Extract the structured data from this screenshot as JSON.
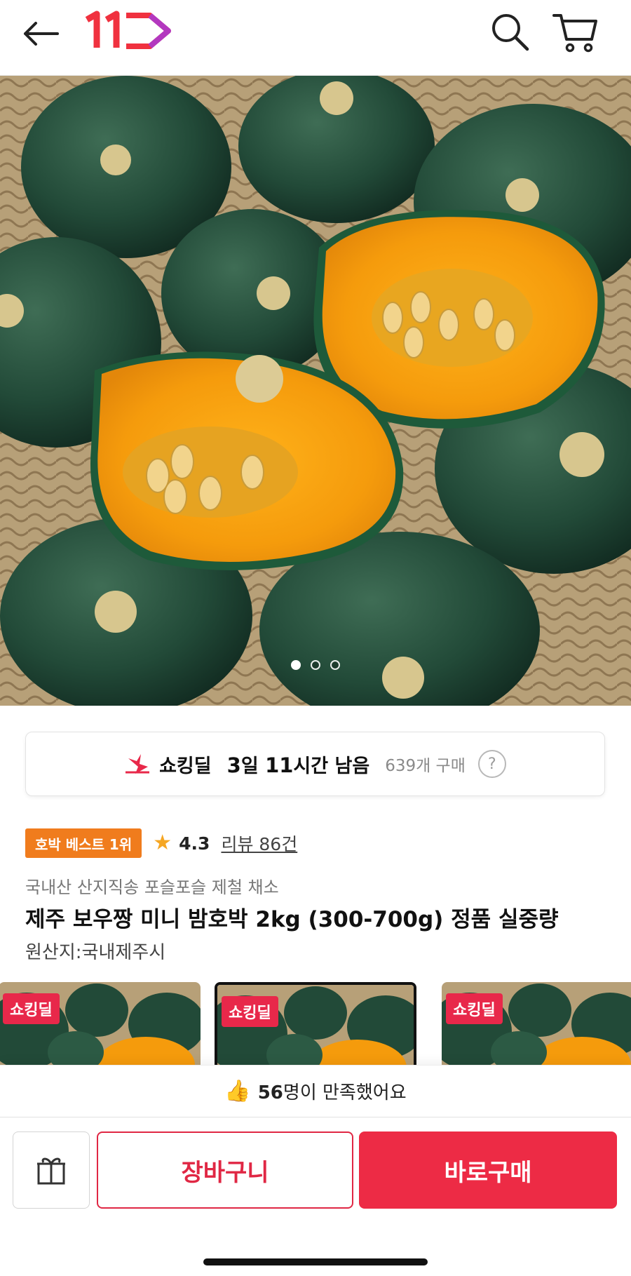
{
  "header": {
    "back_icon": "arrow-left-icon",
    "logo_text": "11",
    "logo_color": "#f0313f",
    "search_icon": "search-icon",
    "cart_icon": "cart-icon"
  },
  "hero": {
    "image": "pumpkin-photo",
    "slide_count": 3,
    "active_slide": 1
  },
  "deal": {
    "icon": "lightning-deal-icon",
    "name": "쇼킹딜",
    "time_left": "3일 11시간 남음",
    "purchase_count": "639개 구매",
    "help_icon_text": "?"
  },
  "product": {
    "rank_badge": "호박 베스트 1위",
    "rating": "4.3",
    "review_link": "리뷰 86건",
    "subtitle": "국내산 산지직송 포슬포슬 제철 채소",
    "title": "제주 보우짱 미니 밤호박 2kg (300-700g) 정품 실중량",
    "origin": "원산지:국내제주시"
  },
  "thumbnails": [
    {
      "badge": "쇼킹딜",
      "selected": false
    },
    {
      "badge": "쇼킹딜",
      "selected": true
    },
    {
      "badge": "쇼킹딜",
      "selected": false
    }
  ],
  "satisfaction": {
    "icon": "thumbs-up-icon",
    "text": "56명이 만족했어요"
  },
  "actions": {
    "gift_icon": "gift-icon",
    "cart_label": "장바구니",
    "buy_label": "바로구매",
    "accent": "#ed2b45"
  }
}
